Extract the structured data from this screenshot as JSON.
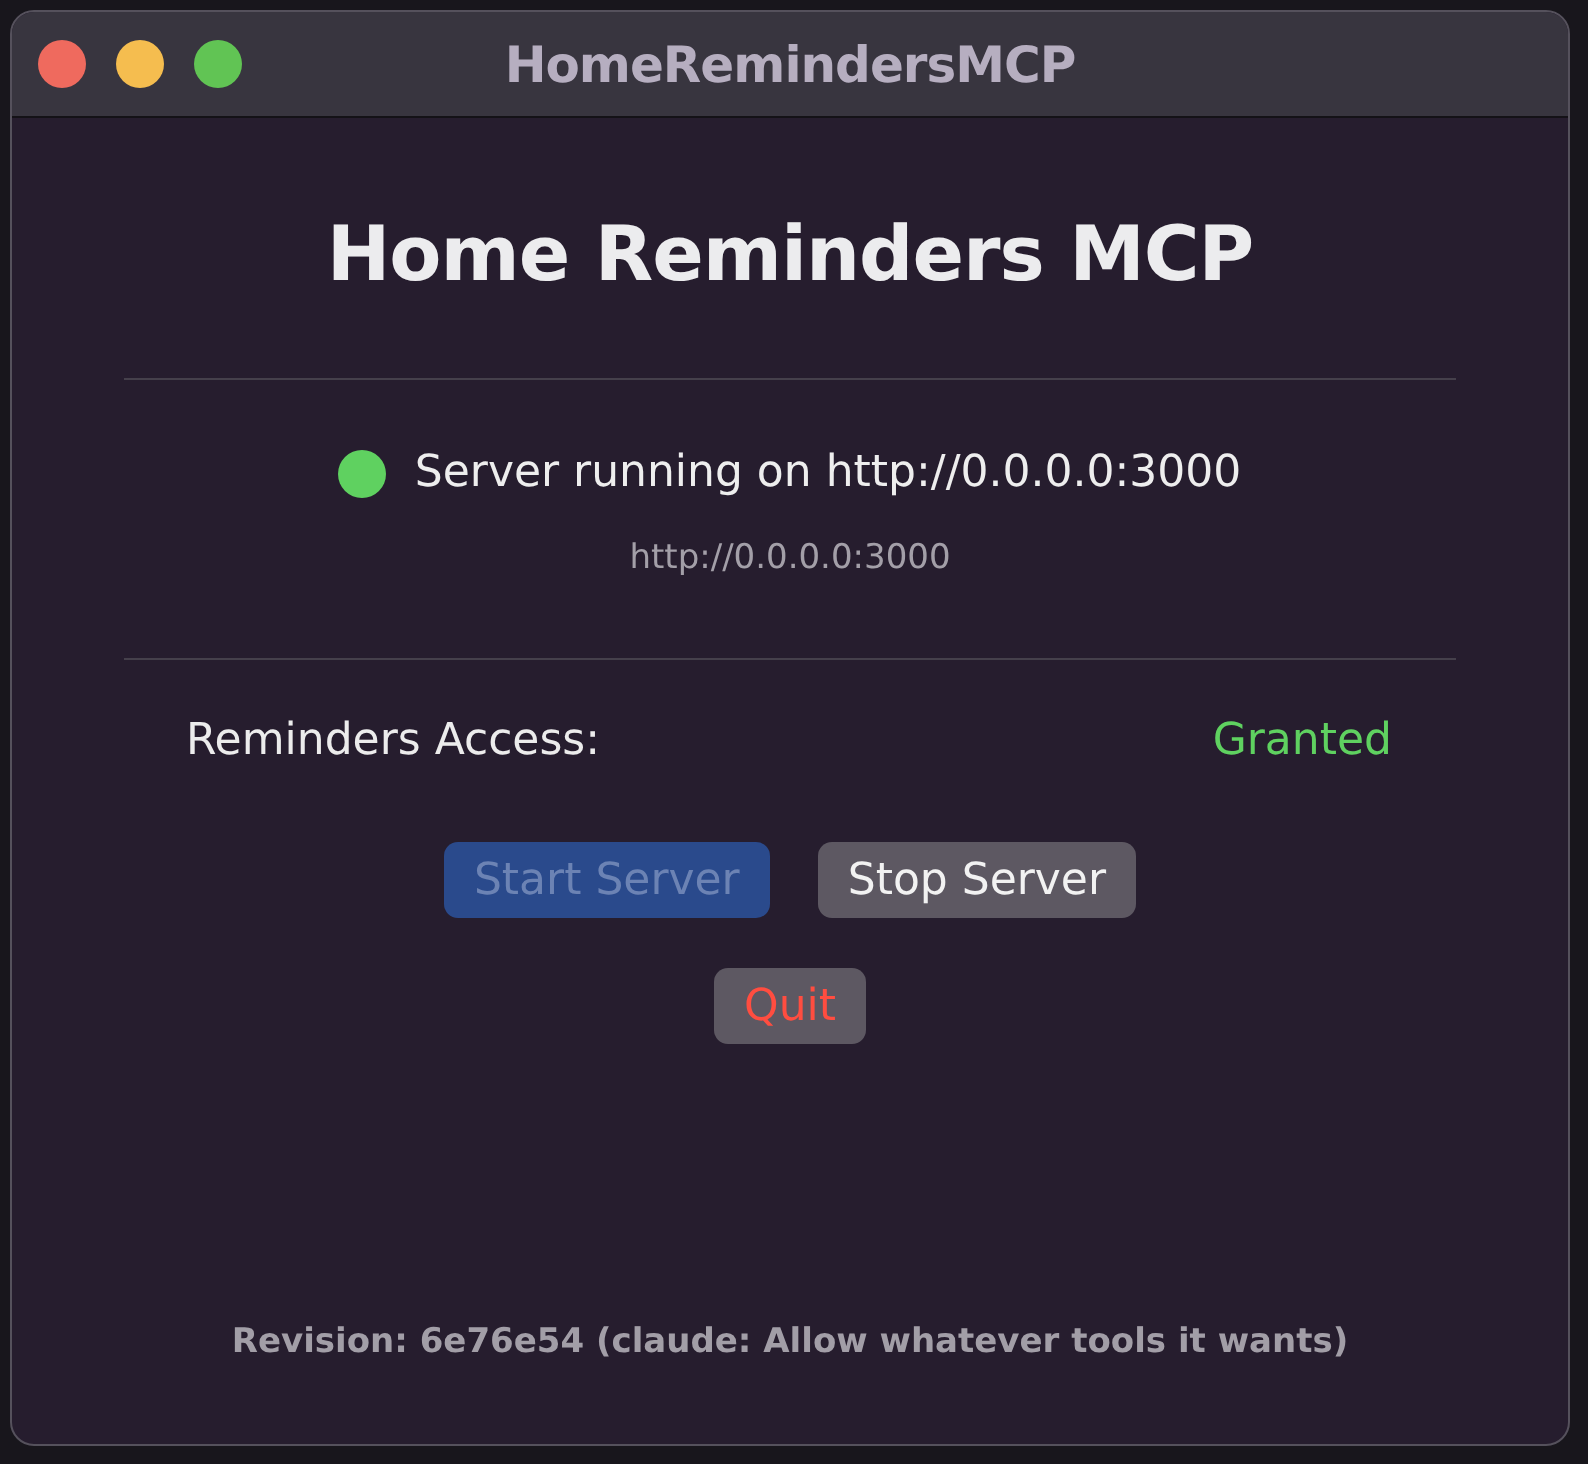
{
  "window": {
    "title": "HomeRemindersMCP",
    "controls": [
      {
        "kind": "close"
      },
      {
        "kind": "minimize"
      },
      {
        "kind": "zoom"
      }
    ]
  },
  "heading": "Home Reminders MCP",
  "server": {
    "running": true,
    "message": "Server running on http://0.0.0.0:3000",
    "url": "http://0.0.0.0:3000"
  },
  "access": {
    "label": "Reminders Access:",
    "value": "Granted",
    "granted": true
  },
  "buttons": [
    {
      "label": "Start Server",
      "kind": "primary",
      "disabled": true
    },
    {
      "label": "Stop Server",
      "kind": "default",
      "disabled": false
    },
    {
      "label": "Quit",
      "kind": "destructive",
      "disabled": false
    }
  ],
  "revision": "Revision: 6e76e54 (claude: Allow whatever tools it wants)"
}
